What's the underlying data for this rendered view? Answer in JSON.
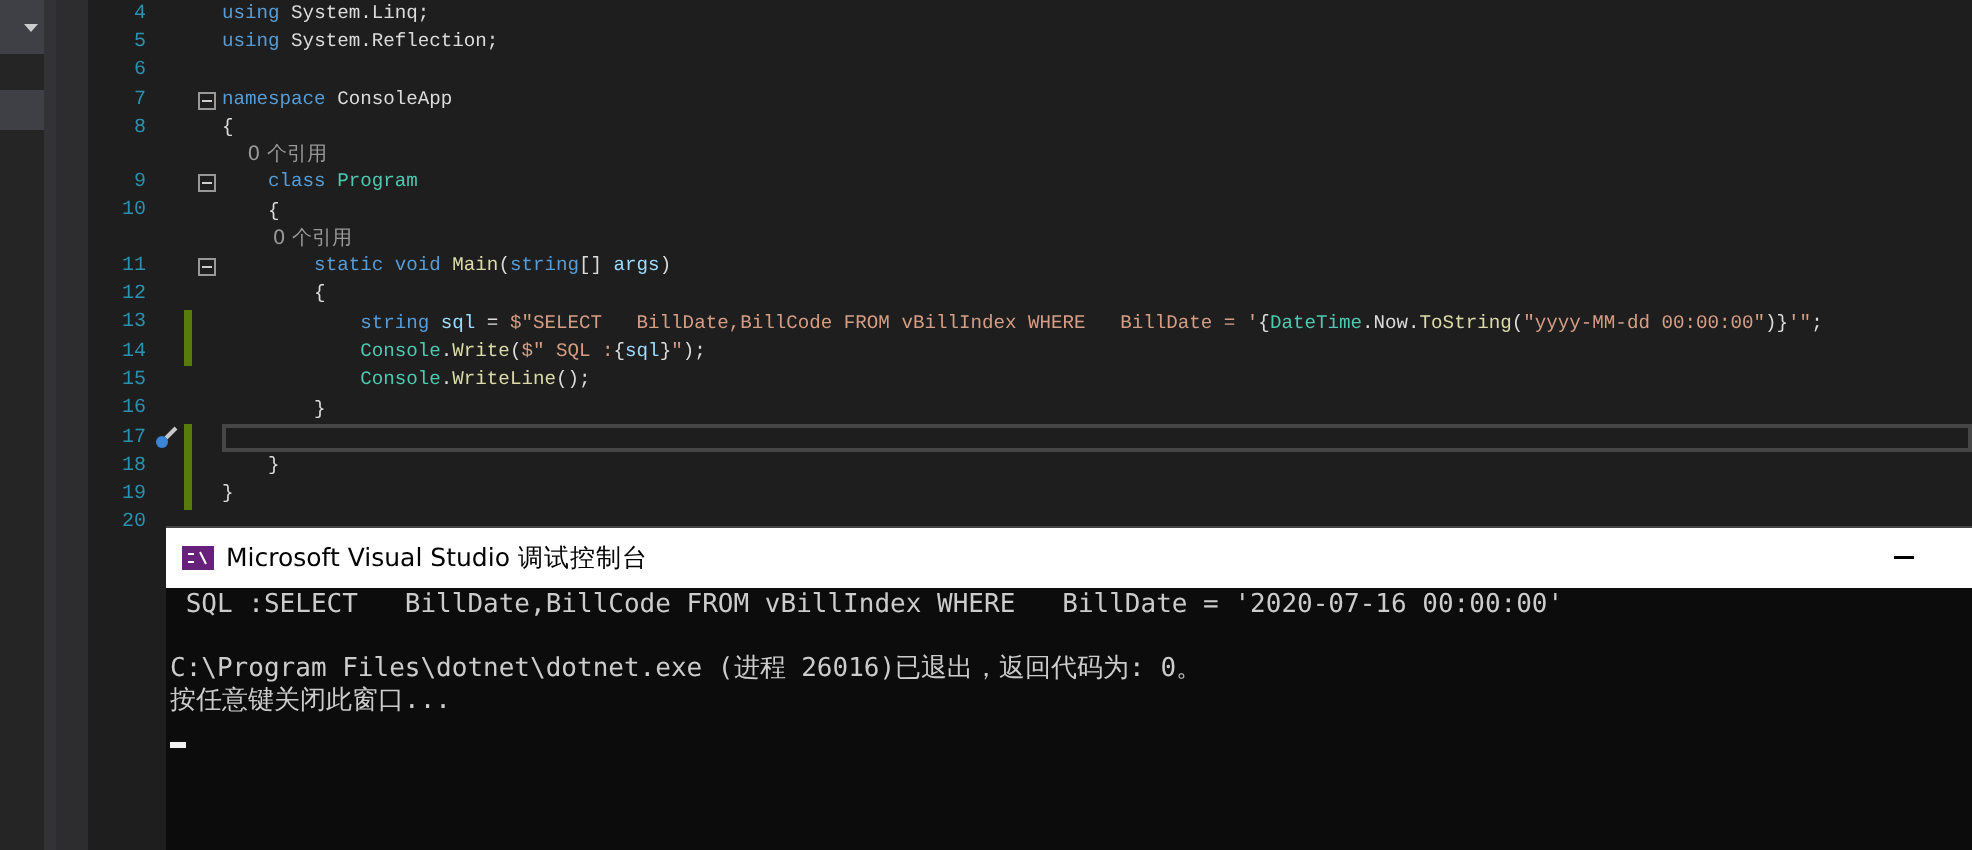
{
  "editor": {
    "lines": [
      {
        "kind": "code",
        "number": "4",
        "changed": false,
        "current": false,
        "fold": false,
        "quick_action": false,
        "tokens": [
          {
            "text": "using",
            "kind": "keyword"
          },
          {
            "text": " System.Linq;",
            "kind": "plain"
          }
        ]
      },
      {
        "kind": "code",
        "number": "5",
        "changed": false,
        "current": false,
        "fold": false,
        "quick_action": false,
        "tokens": [
          {
            "text": "using",
            "kind": "keyword"
          },
          {
            "text": " System.Reflection;",
            "kind": "plain"
          }
        ]
      },
      {
        "kind": "code",
        "number": "6",
        "changed": false,
        "current": false,
        "fold": false,
        "quick_action": false
      },
      {
        "kind": "code",
        "number": "7",
        "changed": false,
        "current": false,
        "fold": true,
        "quick_action": false,
        "tokens": [
          {
            "text": "namespace",
            "kind": "keyword"
          },
          {
            "text": " ConsoleApp",
            "kind": "plain"
          }
        ]
      },
      {
        "kind": "code",
        "number": "8",
        "changed": false,
        "current": false,
        "fold": false,
        "quick_action": false,
        "tokens": [
          {
            "text": "{",
            "kind": "plain"
          }
        ]
      },
      {
        "kind": "codelens",
        "text": "    0 个引用"
      },
      {
        "kind": "code",
        "number": "9",
        "changed": false,
        "current": false,
        "fold": true,
        "quick_action": false,
        "tokens": [
          {
            "text": "    class",
            "kind": "keyword"
          },
          {
            "text": " Program",
            "kind": "type"
          }
        ]
      },
      {
        "kind": "code",
        "number": "10",
        "changed": false,
        "current": false,
        "fold": false,
        "quick_action": false,
        "tokens": [
          {
            "text": "    {",
            "kind": "plain"
          }
        ]
      },
      {
        "kind": "codelens",
        "text": "        0 个引用"
      },
      {
        "kind": "code",
        "number": "11",
        "changed": false,
        "current": false,
        "fold": true,
        "quick_action": false,
        "tokens": [
          {
            "text": "        static void",
            "kind": "keyword"
          },
          {
            "text": " Main",
            "kind": "method"
          },
          {
            "text": "(",
            "kind": "plain"
          },
          {
            "text": "string",
            "kind": "keyword"
          },
          {
            "text": "[] ",
            "kind": "plain"
          },
          {
            "text": "args",
            "kind": "param"
          },
          {
            "text": ")",
            "kind": "plain"
          }
        ]
      },
      {
        "kind": "code",
        "number": "12",
        "changed": false,
        "current": false,
        "fold": false,
        "quick_action": false,
        "tokens": [
          {
            "text": "        {",
            "kind": "plain"
          }
        ]
      },
      {
        "kind": "code",
        "number": "13",
        "changed": true,
        "current": false,
        "fold": false,
        "quick_action": false,
        "tokens": [
          {
            "text": "            string",
            "kind": "keyword"
          },
          {
            "text": " sql",
            "kind": "param"
          },
          {
            "text": " = ",
            "kind": "plain"
          },
          {
            "text": "$\"SELECT   BillDate,BillCode FROM vBillIndex WHERE   BillDate = '",
            "kind": "string"
          },
          {
            "text": "{",
            "kind": "plain"
          },
          {
            "text": "DateTime",
            "kind": "type"
          },
          {
            "text": ".Now.",
            "kind": "plain"
          },
          {
            "text": "ToString",
            "kind": "method"
          },
          {
            "text": "(",
            "kind": "plain"
          },
          {
            "text": "\"yyyy-MM-dd 00:00:00\"",
            "kind": "string"
          },
          {
            "text": ")}",
            "kind": "plain"
          },
          {
            "text": "'\"",
            "kind": "string"
          },
          {
            "text": ";",
            "kind": "plain"
          }
        ]
      },
      {
        "kind": "code",
        "number": "14",
        "changed": true,
        "current": false,
        "fold": false,
        "quick_action": false,
        "tokens": [
          {
            "text": "            Console",
            "kind": "type"
          },
          {
            "text": ".",
            "kind": "plain"
          },
          {
            "text": "Write",
            "kind": "method"
          },
          {
            "text": "(",
            "kind": "plain"
          },
          {
            "text": "$\" SQL :",
            "kind": "string"
          },
          {
            "text": "{",
            "kind": "plain"
          },
          {
            "text": "sql",
            "kind": "param"
          },
          {
            "text": "}",
            "kind": "plain"
          },
          {
            "text": "\"",
            "kind": "string"
          },
          {
            "text": ");",
            "kind": "plain"
          }
        ]
      },
      {
        "kind": "code",
        "number": "15",
        "changed": false,
        "current": false,
        "fold": false,
        "quick_action": false,
        "tokens": [
          {
            "text": "            Console",
            "kind": "type"
          },
          {
            "text": ".",
            "kind": "plain"
          },
          {
            "text": "WriteLine",
            "kind": "method"
          },
          {
            "text": "();",
            "kind": "plain"
          }
        ]
      },
      {
        "kind": "code",
        "number": "16",
        "changed": false,
        "current": false,
        "fold": false,
        "quick_action": false,
        "tokens": [
          {
            "text": "        }",
            "kind": "plain"
          }
        ]
      },
      {
        "kind": "code",
        "number": "17",
        "changed": true,
        "current": true,
        "fold": false,
        "quick_action": true
      },
      {
        "kind": "code",
        "number": "18",
        "changed": true,
        "current": false,
        "fold": false,
        "quick_action": false,
        "tokens": [
          {
            "text": "    }",
            "kind": "plain"
          }
        ]
      },
      {
        "kind": "code",
        "number": "19",
        "changed": true,
        "current": false,
        "fold": false,
        "quick_action": false,
        "tokens": [
          {
            "text": "}",
            "kind": "plain"
          }
        ]
      },
      {
        "kind": "code",
        "number": "20",
        "changed": false,
        "current": false,
        "fold": false,
        "quick_action": false
      }
    ]
  },
  "console": {
    "title": "Microsoft Visual Studio 调试控制台",
    "cursor": true,
    "blocks": [
      {
        "lines": [
          " SQL :SELECT   BillDate,BillCode FROM vBillIndex WHERE   BillDate = '2020-07-16 00:00:00'"
        ]
      },
      {
        "lines": [
          "C:\\Program Files\\dotnet\\dotnet.exe (进程 26016)已退出，返回代码为: 0。",
          "按任意键关闭此窗口..."
        ]
      }
    ]
  }
}
